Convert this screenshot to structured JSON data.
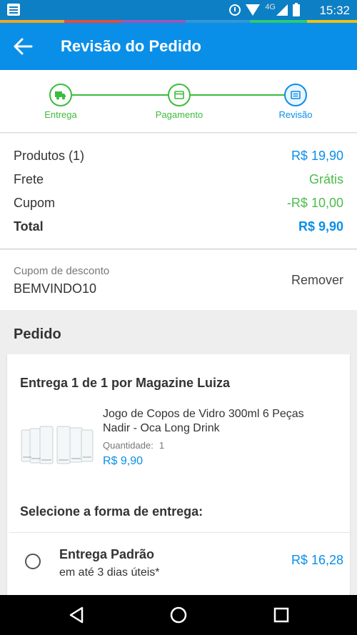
{
  "status_bar": {
    "time": "15:32",
    "network": "4G",
    "icons": [
      "notification-icon",
      "alarm-icon",
      "wifi-icon",
      "signal-icon",
      "battery-icon"
    ]
  },
  "app_bar": {
    "title": "Revisão do Pedido",
    "back_icon": "arrow-left-icon",
    "background": "#0a8fe8"
  },
  "stepper": {
    "steps": [
      {
        "label": "Entrega",
        "icon": "truck-icon",
        "state": "done"
      },
      {
        "label": "Pagamento",
        "icon": "card-icon",
        "state": "done"
      },
      {
        "label": "Revisão",
        "icon": "list-icon",
        "state": "current"
      }
    ],
    "done_color": "#3dbb3d",
    "current_color": "#0a8fe8"
  },
  "summary": {
    "rows": [
      {
        "label": "Produtos (1)",
        "value": "R$ 19,90"
      },
      {
        "label": "Frete",
        "value": "Grátis"
      },
      {
        "label": "Cupom",
        "value": "-R$ 10,00"
      },
      {
        "label": "Total",
        "value": "R$ 9,90"
      }
    ]
  },
  "coupon": {
    "label": "Cupom de desconto",
    "code": "BEMVINDO10",
    "remove_label": "Remover"
  },
  "order": {
    "title": "Pedido",
    "delivery_title": "Entrega 1 de 1 por Magazine Luiza",
    "product": {
      "name": "Jogo de Copos de Vidro 300ml 6 Peças Nadir - Oca Long Drink",
      "quantity_label": "Quantidade:",
      "quantity_value": "1",
      "price": "R$ 9,90"
    },
    "select_title": "Selecione a forma de entrega:",
    "shipping_option": {
      "name": "Entrega Padrão",
      "time": "em até 3 dias úteis*",
      "price": "R$ 16,28"
    }
  }
}
